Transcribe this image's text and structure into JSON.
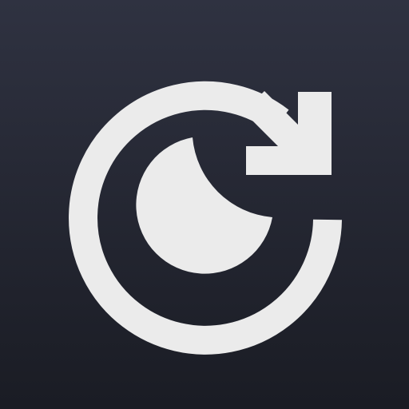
{
  "icon": {
    "name": "refresh-icon",
    "glyph_color": "#ebebeb",
    "background_top": "#2f3241",
    "background_bottom": "#1a1c24"
  }
}
